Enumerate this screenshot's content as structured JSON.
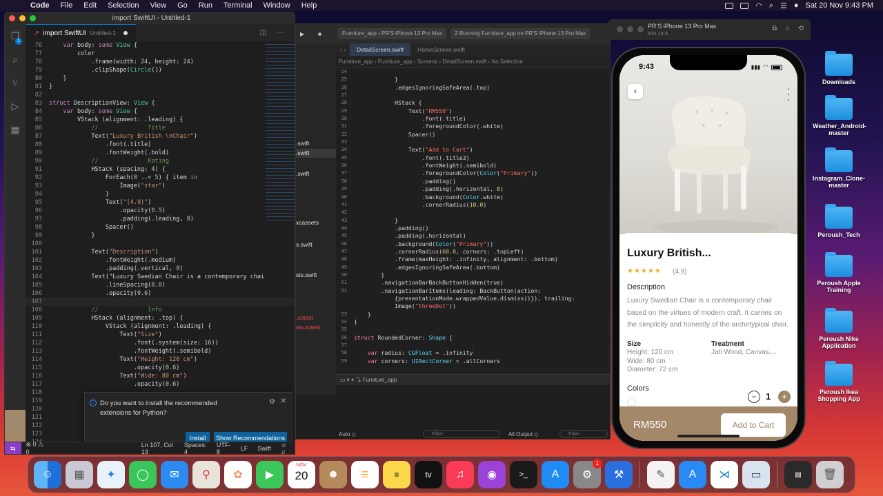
{
  "menubar": {
    "app": "Code",
    "items": [
      "File",
      "Edit",
      "Selection",
      "View",
      "Go",
      "Run",
      "Terminal",
      "Window",
      "Help"
    ],
    "datetime": "Sat 20 Nov  9:43 PM"
  },
  "vscode": {
    "window_title": "import SwiftUI - Untitled-1",
    "tab_label": "import SwiftUI",
    "tab_sub": "Untitled-1",
    "notification": {
      "message": "Do you want to install the recommended extensions for Python?",
      "install": "Install",
      "show": "Show Recommendations"
    },
    "status": {
      "errors": "⊗ 0 ⚠ 0",
      "position": "Ln 107, Col 13",
      "spaces": "Spaces: 4",
      "encoding": "UTF-8",
      "eol": "LF",
      "language": "Swift"
    },
    "lines": [
      {
        "n": "76",
        "c": "    var body: some View {"
      },
      {
        "n": "77",
        "c": "        color"
      },
      {
        "n": "78",
        "c": "            .frame(width: 24, height: 24)"
      },
      {
        "n": "79",
        "c": "            .clipShape(Circle())"
      },
      {
        "n": "80",
        "c": "    }"
      },
      {
        "n": "81",
        "c": "}"
      },
      {
        "n": "82",
        "c": ""
      },
      {
        "n": "83",
        "c": "struct DescriptionView: View {"
      },
      {
        "n": "84",
        "c": "    var body: some View {"
      },
      {
        "n": "85",
        "c": "        VStack (alignment: .leading) {"
      },
      {
        "n": "86",
        "c": "            //              Title"
      },
      {
        "n": "87",
        "c": "            Text(\"Luxury British \\nChair\")"
      },
      {
        "n": "88",
        "c": "                .font(.title)"
      },
      {
        "n": "89",
        "c": "                .fontWeight(.bold)"
      },
      {
        "n": "90",
        "c": "            //              Rating"
      },
      {
        "n": "91",
        "c": "            HStack (spacing: 4) {"
      },
      {
        "n": "92",
        "c": "                ForEach(0 ..< 5) { item in"
      },
      {
        "n": "93",
        "c": "                    Image(\"star\")"
      },
      {
        "n": "94",
        "c": "                }"
      },
      {
        "n": "95",
        "c": "                Text(\"(4.9)\")"
      },
      {
        "n": "96",
        "c": "                    .opacity(0.5)"
      },
      {
        "n": "97",
        "c": "                    .padding(.leading, 8)"
      },
      {
        "n": "98",
        "c": "                Spacer()"
      },
      {
        "n": "99",
        "c": "            }"
      },
      {
        "n": "100",
        "c": ""
      },
      {
        "n": "101",
        "c": "            Text(\"Description\")"
      },
      {
        "n": "102",
        "c": "                .fontWeight(.medium)"
      },
      {
        "n": "103",
        "c": "                .padding(.vertical, 8)"
      },
      {
        "n": "104",
        "c": "            Text(\"Luxury Swedian Chair is a contemporary chai"
      },
      {
        "n": "105",
        "c": "                .lineSpacing(8.0)"
      },
      {
        "n": "106",
        "c": "                .opacity(0.6)"
      },
      {
        "n": "107",
        "c": ""
      },
      {
        "n": "108",
        "c": "            //              Info"
      },
      {
        "n": "109",
        "c": "            HStack (alignment: .top) {"
      },
      {
        "n": "110",
        "c": "                VStack (alignment: .leading) {"
      },
      {
        "n": "111",
        "c": "                    Text(\"Size\")"
      },
      {
        "n": "112",
        "c": "                        .font(.system(size: 16))"
      },
      {
        "n": "113",
        "c": "                        .fontWeight(.semibold)"
      },
      {
        "n": "114",
        "c": "                    Text(\"Height: 120 cm\")"
      },
      {
        "n": "115",
        "c": "                        .opacity(0.6)"
      },
      {
        "n": "116",
        "c": "                    Text(\"Wide: 80 cm\")"
      },
      {
        "n": "117",
        "c": "                        .opacity(0.6)"
      },
      {
        "n": "118",
        "c": ""
      },
      {
        "n": "119",
        "c": ""
      },
      {
        "n": "120",
        "c": ""
      },
      {
        "n": "121",
        "c": ""
      },
      {
        "n": "122",
        "c": ""
      },
      {
        "n": "123",
        "c": ""
      },
      {
        "n": "124",
        "c": "                Spacer()"
      }
    ]
  },
  "xcode": {
    "scheme": "Furniture_app",
    "device": "PR'S iPhone 13 Pro Max",
    "run_status": "Running Furniture_app on PR'S iPhone 13 Pro Max",
    "run_badge": "2",
    "tabs": [
      "DetailScreen.swift",
      "HomeScreen.swift"
    ],
    "breadcrumb": "Furniture_app  ›  Furniture_app  ›  Screens  ›  DetailScreen.swift  ›  No Selection",
    "nav_files": [
      ".swift",
      ".swift",
      ".swift",
      "xcassets",
      "s.swift",
      "sts.swift",
      ".xctest",
      "sts.xctest"
    ],
    "debug_label": "Furniture_app",
    "footer": {
      "auto": "Auto ◇",
      "all_output": "All Output ◇",
      "filter": "Filter"
    },
    "lines": [
      {
        "n": "24",
        "c": ""
      },
      {
        "n": "25",
        "c": "            }"
      },
      {
        "n": "26",
        "c": "            .edgesIgnoringSafeArea(.top)"
      },
      {
        "n": "27",
        "c": ""
      },
      {
        "n": "28",
        "c": "            HStack {"
      },
      {
        "n": "29",
        "c": "                Text(\"RM550\")"
      },
      {
        "n": "30",
        "c": "                    .font(.title)"
      },
      {
        "n": "31",
        "c": "                    .foregroundColor(.white)"
      },
      {
        "n": "32",
        "c": "                Spacer()"
      },
      {
        "n": "33",
        "c": ""
      },
      {
        "n": "34",
        "c": "                Text(\"Add to Cart\")"
      },
      {
        "n": "35",
        "c": "                    .font(.title3)"
      },
      {
        "n": "36",
        "c": "                    .fontWeight(.semibold)"
      },
      {
        "n": "37",
        "c": "                    .foregroundColor(Color(\"Primary\"))"
      },
      {
        "n": "38",
        "c": "                    .padding()"
      },
      {
        "n": "39",
        "c": "                    .padding(.horizontal, 8)"
      },
      {
        "n": "40",
        "c": "                    .background(Color.white)"
      },
      {
        "n": "41",
        "c": "                    .cornerRadius(10.0)"
      },
      {
        "n": "42",
        "c": ""
      },
      {
        "n": "43",
        "c": "            }"
      },
      {
        "n": "44",
        "c": "            .padding()"
      },
      {
        "n": "45",
        "c": "            .padding(.horizontal)"
      },
      {
        "n": "46",
        "c": "            .background(Color(\"Primary\"))"
      },
      {
        "n": "47",
        "c": "            .cornerRadius(60.0, corners: .topLeft)"
      },
      {
        "n": "48",
        "c": "            .frame(maxHeight: .infinity, alignment: .bottom)"
      },
      {
        "n": "49",
        "c": "            .edgesIgnoringSafeArea(.bottom)"
      },
      {
        "n": "50",
        "c": "        }"
      },
      {
        "n": "51",
        "c": "        .navigationBarBackButtonHidden(true)"
      },
      {
        "n": "52",
        "c": "        .navigationBarItems(leading: BackButton(action:"
      },
      {
        "n": "",
        "c": "            {presentationMode.wrappedValue.dismiss()}), trailing:"
      },
      {
        "n": "",
        "c": "            Image(\"threeDot\"))"
      },
      {
        "n": "53",
        "c": "    }"
      },
      {
        "n": "54",
        "c": "}"
      },
      {
        "n": "55",
        "c": ""
      },
      {
        "n": "56",
        "c": "struct RoundedCorner: Shape {"
      },
      {
        "n": "57",
        "c": ""
      },
      {
        "n": "58",
        "c": "    var radius: CGFloat = .infinity"
      },
      {
        "n": "59",
        "c": "    var corners: UIRectCorner = .allCorners"
      }
    ]
  },
  "simulator": {
    "title": "PR'S iPhone 13 Pro Max",
    "os": "iOS 14.5",
    "time": "9:43",
    "product": {
      "title": "Luxury British...",
      "stars": "★★★★★",
      "rating": "(4.9)",
      "desc_head": "Description",
      "desc": "Luxury Swedian Chair is a contemporary chair based on the virtues of modern craft. It carries on the simplicity and honestly of the archetypical chair.",
      "size_head": "Size",
      "size_lines": [
        "Height: 120 cm",
        "Wide: 80 cm",
        "Diameter: 72 cm"
      ],
      "treat_head": "Treatment",
      "treat_value": "Jati Wood, Canvas,...",
      "colors_head": "Colors",
      "colors": [
        "#ffffff",
        "#111111",
        "#2aa2b3"
      ],
      "qty": "1",
      "price": "RM550",
      "add_to_cart": "Add to Cart"
    }
  },
  "desktop_icons": [
    "Downloads",
    "Weather_Android-master",
    "Instagram_Clone-master",
    "Peroush_Tech",
    "Peroush Apple Training",
    "Peroush Nike Application",
    "Peroush Ikea Shopping App"
  ],
  "dock": {
    "calendar_month": "NOV",
    "calendar_day": "20",
    "settings_badge": "1",
    "tv": "tv"
  }
}
